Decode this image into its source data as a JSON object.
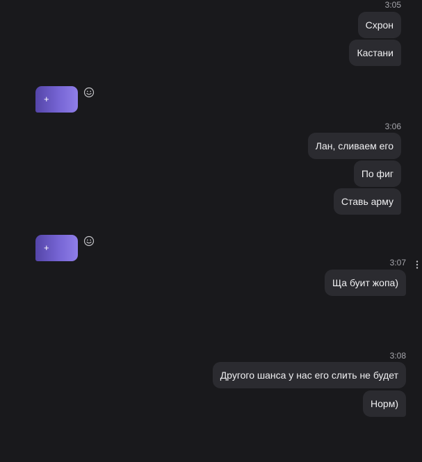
{
  "chat": {
    "groups": [
      {
        "time": "3:05",
        "messages": [
          "Схрон",
          "Кастани"
        ]
      },
      {
        "time": "3:06",
        "messages": [
          "Лан, сливаем его",
          "По фиг",
          "Ставь арму"
        ]
      },
      {
        "time": "3:07",
        "messages": [
          "Ща буит жопа)"
        ]
      },
      {
        "time": "3:08",
        "messages": [
          "Другого шанса у нас его слить не будет",
          "Норм)"
        ]
      }
    ],
    "incoming": [
      {
        "sticker_label": "+"
      },
      {
        "sticker_label": "+"
      }
    ]
  },
  "icons": {
    "reaction": "smiley-icon",
    "message_menu": "more-vertical-icon"
  },
  "colors": {
    "background": "#19191c",
    "bubble": "#2b2b30",
    "gradient_start": "#5445a8",
    "gradient_end": "#8f7ee8"
  }
}
